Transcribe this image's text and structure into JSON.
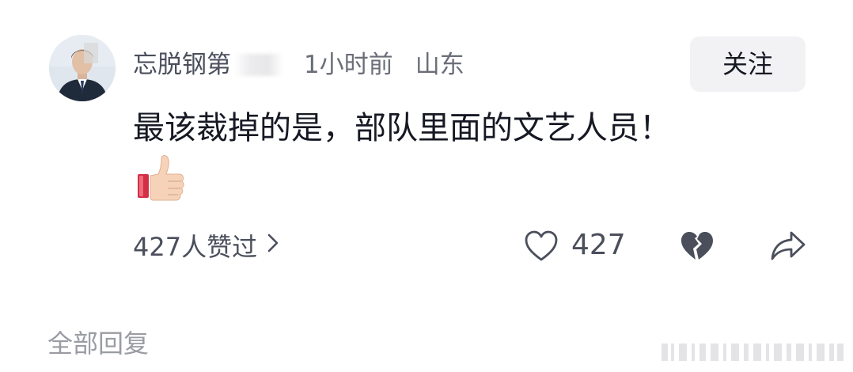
{
  "comment": {
    "username": "忘脱钢第",
    "time": "1小时前",
    "location": "山东",
    "follow_label": "关注",
    "text": "最该裁掉的是，部队里面的文艺人员！",
    "emoji_icon": "thumbs-up-emoji",
    "likes_summary": "427人赞过",
    "like_count": "427"
  },
  "footer": {
    "all_replies_label": "全部回复"
  },
  "colors": {
    "primary_text": "#161823",
    "secondary_text": "#6b6e78",
    "muted_text": "#9a9ca3",
    "button_bg": "#f2f2f4",
    "icon_stroke": "#4b4f5c"
  }
}
